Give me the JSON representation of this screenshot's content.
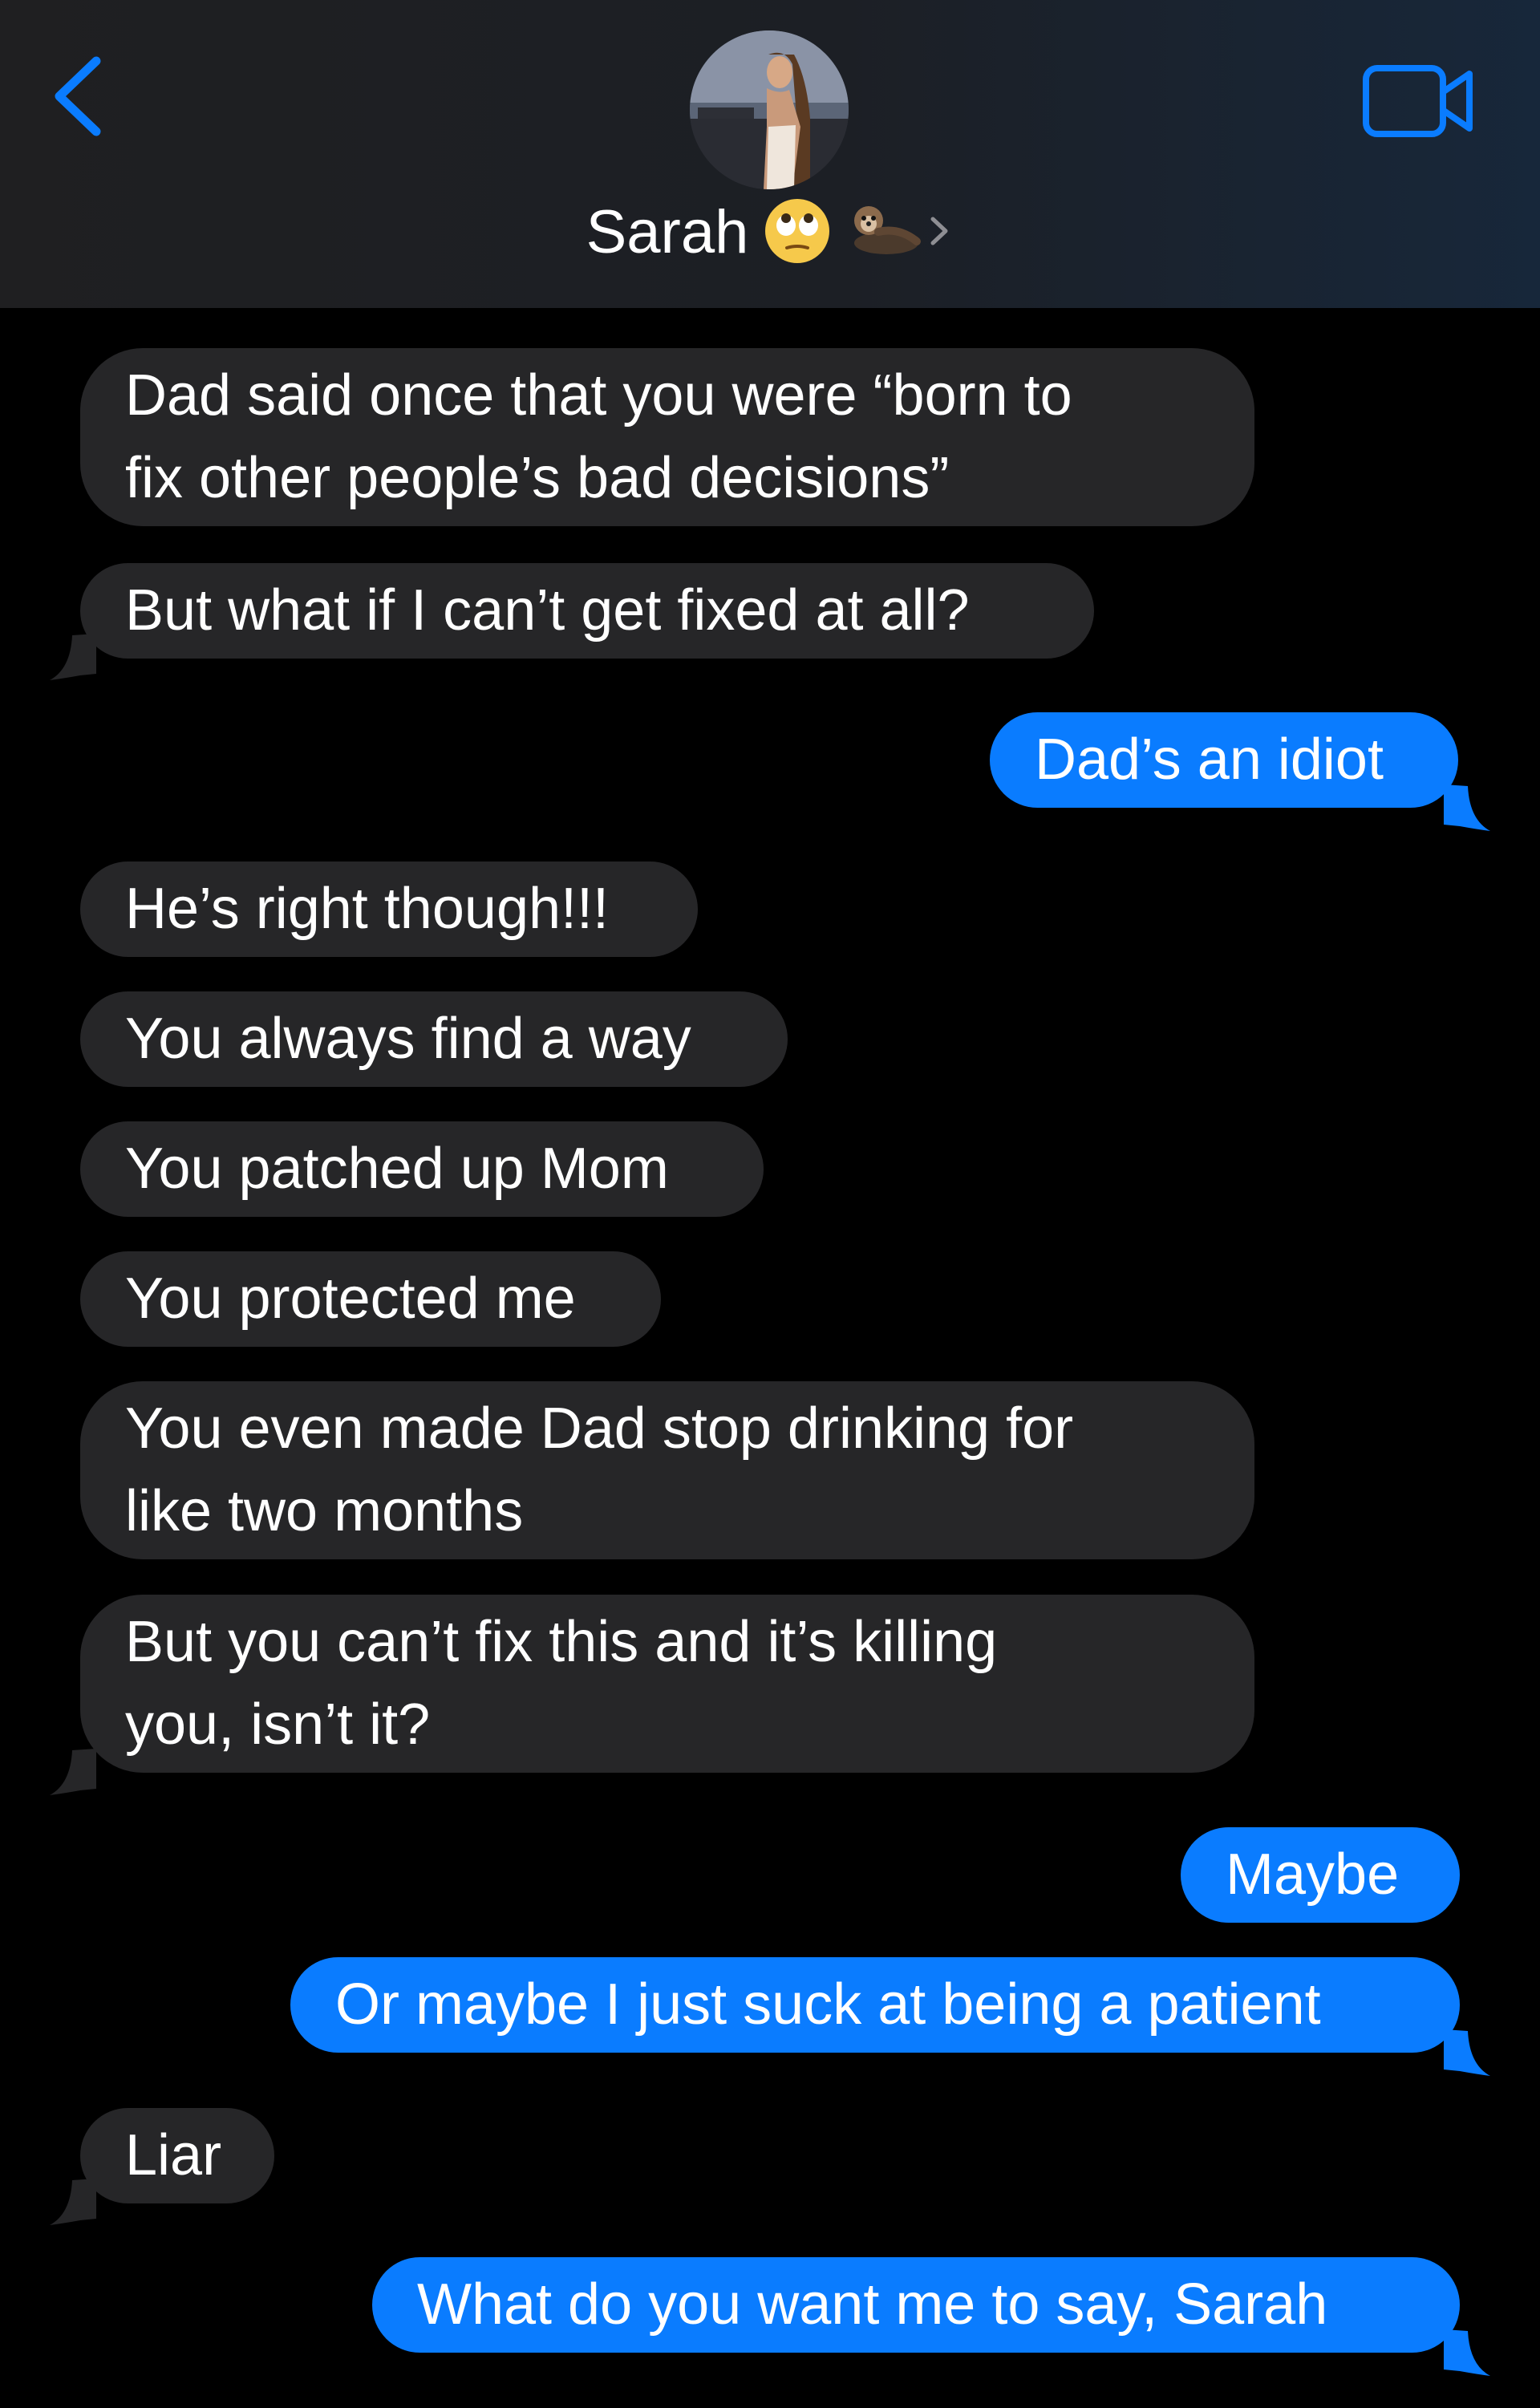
{
  "header": {
    "contact_name": "Sarah",
    "name_emojis": [
      "face-with-rolling-eyes-icon",
      "otter-icon"
    ],
    "back_icon": "chevron-left-icon",
    "video_icon": "video-camera-icon",
    "colors": {
      "accent": "#0a7cff",
      "header_bg": "#1f1f21"
    }
  },
  "messages": [
    {
      "sender": "contact",
      "lines": [
        "Dad said once that you were “born to",
        "fix other people’s bad decisions”"
      ]
    },
    {
      "sender": "contact",
      "lines": [
        "But what if I can’t get fixed at all?"
      ]
    },
    {
      "sender": "me",
      "lines": [
        "Dad’s an idiot"
      ]
    },
    {
      "sender": "contact",
      "lines": [
        "He’s right though!!!"
      ]
    },
    {
      "sender": "contact",
      "lines": [
        "You always find a way"
      ]
    },
    {
      "sender": "contact",
      "lines": [
        "You patched up Mom"
      ]
    },
    {
      "sender": "contact",
      "lines": [
        "You protected me"
      ]
    },
    {
      "sender": "contact",
      "lines": [
        "You even made Dad stop drinking for",
        "like two months"
      ]
    },
    {
      "sender": "contact",
      "lines": [
        "But you can’t fix this and it’s killing",
        "you, isn’t it?"
      ]
    },
    {
      "sender": "me",
      "lines": [
        "Maybe"
      ]
    },
    {
      "sender": "me",
      "lines": [
        "Or maybe I just suck at being a patient"
      ]
    },
    {
      "sender": "contact",
      "lines": [
        "Liar"
      ]
    },
    {
      "sender": "me",
      "lines": [
        "What do you want me to say, Sarah"
      ]
    }
  ],
  "colors": {
    "incoming_bubble": "#262628",
    "outgoing_bubble": "#0a7cff",
    "background": "#000000"
  }
}
